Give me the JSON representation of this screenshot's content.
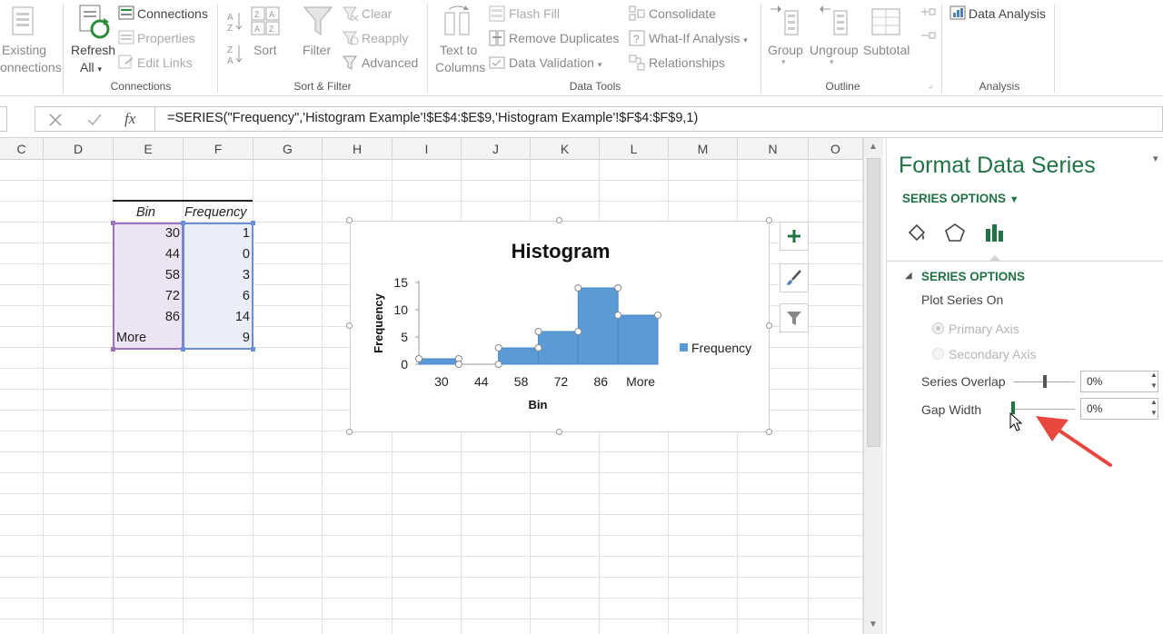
{
  "ribbon": {
    "get_external": {
      "label_line1": "Existing",
      "label_line2": "onnections"
    },
    "connections_group": {
      "refresh_line1": "Refresh",
      "refresh_line2": "All",
      "connections": "Connections",
      "properties": "Properties",
      "edit_links": "Edit Links",
      "group_label": "Connections"
    },
    "sort_filter_group": {
      "sort": "Sort",
      "filter": "Filter",
      "clear": "Clear",
      "reapply": "Reapply",
      "advanced": "Advanced",
      "group_label": "Sort & Filter"
    },
    "data_tools_group": {
      "text_to_line1": "Text to",
      "text_to_line2": "Columns",
      "flash_fill": "Flash Fill",
      "remove_duplicates": "Remove Duplicates",
      "data_validation": "Data Validation",
      "consolidate": "Consolidate",
      "what_if": "What-If Analysis",
      "relationships": "Relationships",
      "group_label": "Data Tools"
    },
    "outline_group": {
      "group": "Group",
      "ungroup": "Ungroup",
      "subtotal": "Subtotal",
      "group_label": "Outline"
    },
    "analysis_group": {
      "data_analysis": "Data Analysis",
      "group_label": "Analysis"
    }
  },
  "formula_bar": {
    "fx": "fx",
    "formula": "=SERIES(\"Frequency\",'Histogram Example'!$E$4:$E$9,'Histogram Example'!$F$4:$F$9,1)"
  },
  "columns": [
    "C",
    "D",
    "E",
    "F",
    "G",
    "H",
    "I",
    "J",
    "K",
    "L",
    "M",
    "N",
    "O"
  ],
  "table": {
    "headers": [
      "Bin",
      "Frequency"
    ],
    "rows": [
      [
        "30",
        "1"
      ],
      [
        "44",
        "0"
      ],
      [
        "58",
        "3"
      ],
      [
        "72",
        "6"
      ],
      [
        "86",
        "14"
      ],
      [
        "More",
        "9"
      ]
    ]
  },
  "chart_data": {
    "type": "bar",
    "title": "Histogram",
    "xlabel": "Bin",
    "ylabel": "Frequency",
    "categories": [
      "30",
      "44",
      "58",
      "72",
      "86",
      "More"
    ],
    "series": [
      {
        "name": "Frequency",
        "values": [
          1,
          0,
          3,
          6,
          14,
          9
        ]
      }
    ],
    "ylim": [
      0,
      15
    ],
    "yticks": [
      "0",
      "5",
      "10",
      "15"
    ],
    "legend": "right",
    "grid": false,
    "color": "#5b9bd5"
  },
  "pane": {
    "title": "Format Data Series",
    "series_options_dropdown": "SERIES OPTIONS",
    "section_header": "SERIES OPTIONS",
    "plot_series_on": "Plot Series On",
    "primary_axis": "Primary Axis",
    "secondary_axis": "Secondary Axis",
    "series_overlap_label": "Series Overlap",
    "series_overlap_value": "0%",
    "gap_width_label": "Gap Width",
    "gap_width_value": "0%"
  },
  "colors": {
    "accent_green": "#217346",
    "arrow_red": "#e8473f"
  }
}
